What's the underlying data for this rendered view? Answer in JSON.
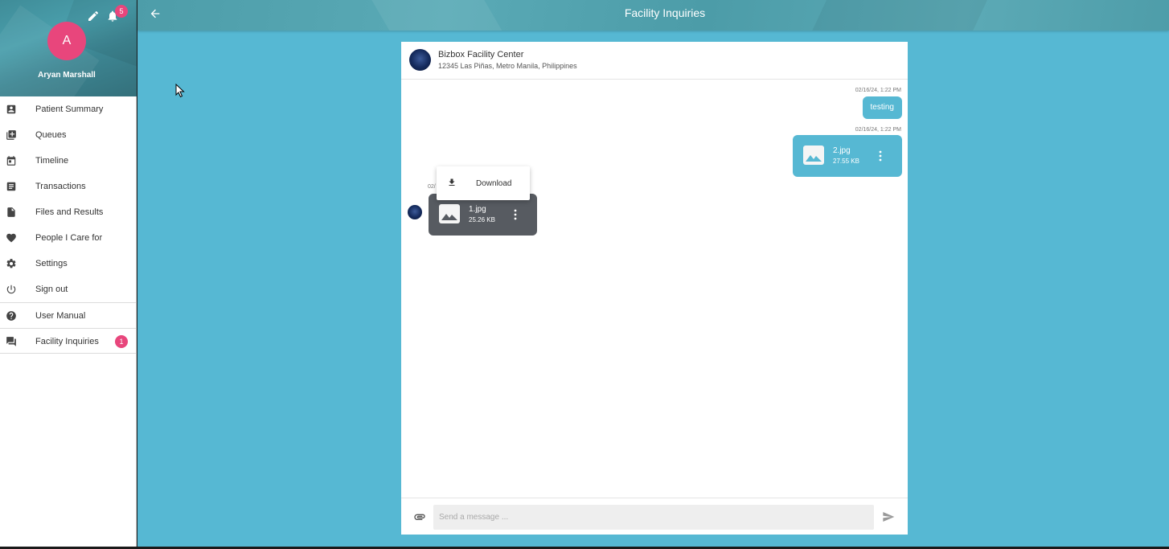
{
  "sidebar": {
    "notification_count": "5",
    "avatar_initial": "A",
    "user_name": "Aryan Marshall",
    "items": [
      {
        "label": "Patient Summary",
        "icon": "account-box-icon"
      },
      {
        "label": "Queues",
        "icon": "queue-add-icon"
      },
      {
        "label": "Timeline",
        "icon": "calendar-icon"
      },
      {
        "label": "Transactions",
        "icon": "list-icon"
      },
      {
        "label": "Files and Results",
        "icon": "file-icon"
      },
      {
        "label": "People I Care for",
        "icon": "heart-icon"
      },
      {
        "label": "Settings",
        "icon": "gear-icon"
      },
      {
        "label": "Sign out",
        "icon": "power-icon"
      },
      {
        "label": "User Manual",
        "icon": "help-icon"
      },
      {
        "label": "Facility Inquiries",
        "icon": "forum-icon",
        "badge": "1"
      }
    ]
  },
  "header": {
    "title": "Facility Inquiries"
  },
  "chat": {
    "facility_name": "Bizbox Facility Center",
    "facility_address": "12345 Las Piñas, Metro Manila, Philippines",
    "messages": [
      {
        "timestamp": "02/16/24, 1:22 PM",
        "text": "testing"
      },
      {
        "timestamp": "02/16/24, 1:22 PM",
        "file_name": "2.jpg",
        "file_size": "27.55 KB"
      },
      {
        "timestamp": "02/",
        "file_name": "1.jpg",
        "file_size": "25.26 KB"
      }
    ],
    "context_menu": {
      "download_label": "Download"
    },
    "input_placeholder": "Send a message ..."
  },
  "colors": {
    "accent": "#56b8d3",
    "badge": "#e8467c",
    "incoming_bubble": "#575b61"
  }
}
